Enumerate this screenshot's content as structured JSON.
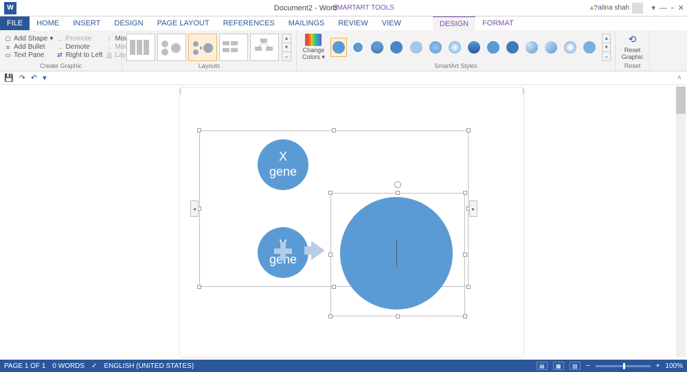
{
  "app": {
    "word_icon": "W",
    "title": "Document2 - Word",
    "contextual": "SMARTART TOOLS"
  },
  "user": {
    "name": "alina shah",
    "warn": "▲"
  },
  "win": {
    "help": "?",
    "min": "—",
    "restore": "▫",
    "close": "✕"
  },
  "tabs": {
    "file": "FILE",
    "main": [
      "HOME",
      "INSERT",
      "DESIGN",
      "PAGE LAYOUT",
      "REFERENCES",
      "MAILINGS",
      "REVIEW",
      "VIEW"
    ],
    "tool": [
      "DESIGN",
      "FORMAT"
    ]
  },
  "ribbon": {
    "create": {
      "label": "Create Graphic",
      "col1": [
        "Add Shape",
        "Add Bullet",
        "Text Pane"
      ],
      "col2": [
        "Promote",
        "Demote",
        "Right to Left"
      ],
      "col3": [
        "Move Up",
        "Move Down",
        "Layout"
      ]
    },
    "layouts_label": "Layouts",
    "colors": {
      "line1": "Change",
      "line2": "Colors"
    },
    "styles_label": "SmartArt Styles",
    "reset": {
      "line1": "Reset",
      "line2": "Graphic",
      "label": "Reset"
    }
  },
  "qat": {
    "save": "💾",
    "undo": "↶",
    "redo": "↷",
    "dd": "▾",
    "collapse": "˄"
  },
  "smartart": {
    "circle1": {
      "l1": "X",
      "l2": "gene"
    },
    "circle2": {
      "l1": "Y",
      "l2": "gene"
    }
  },
  "status": {
    "page": "PAGE 1 OF 1",
    "words": "0 WORDS",
    "proof": "✓",
    "lang": "ENGLISH (UNITED STATES)",
    "views": {
      "read": "▤",
      "print": "▦",
      "web": "▧"
    },
    "zminus": "−",
    "zplus": "+",
    "zoom": "100%"
  }
}
